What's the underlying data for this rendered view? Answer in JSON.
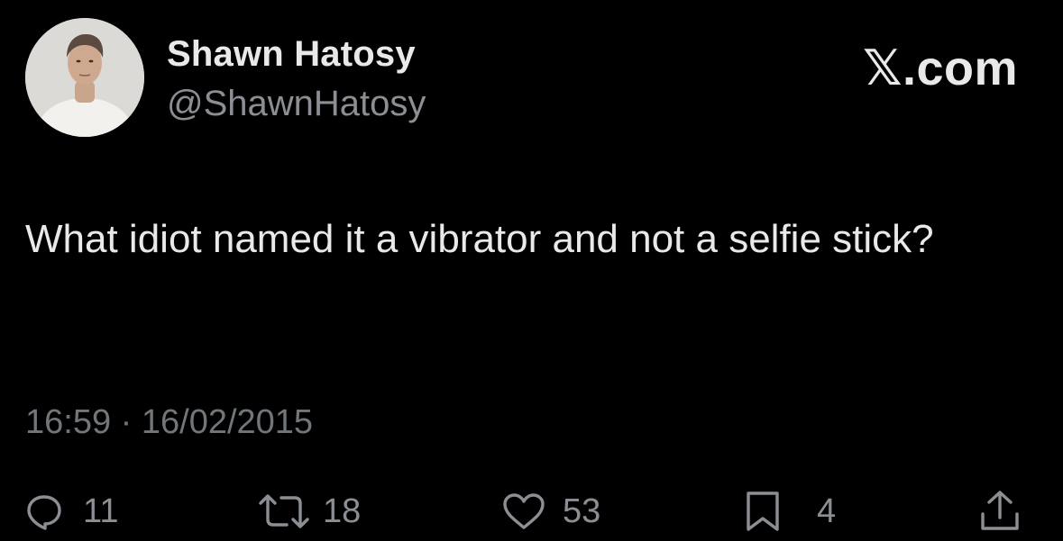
{
  "author": {
    "display_name": "Shawn Hatosy",
    "handle": "@ShawnHatosy"
  },
  "brand": {
    "x_mark": "𝕏",
    "suffix": ".com"
  },
  "tweet": {
    "text": "What idiot named it a vibrator and not a selfie stick?",
    "timestamp": "16:59 · 16/02/2015"
  },
  "actions": {
    "replies": "11",
    "reposts": "18",
    "likes": "53",
    "bookmarks": "4"
  },
  "colors": {
    "background": "#000000",
    "primary_text": "#e7e9ea",
    "secondary_text": "#71767b"
  },
  "icons": [
    "reply-icon",
    "repost-icon",
    "like-icon",
    "bookmark-icon",
    "share-icon"
  ]
}
